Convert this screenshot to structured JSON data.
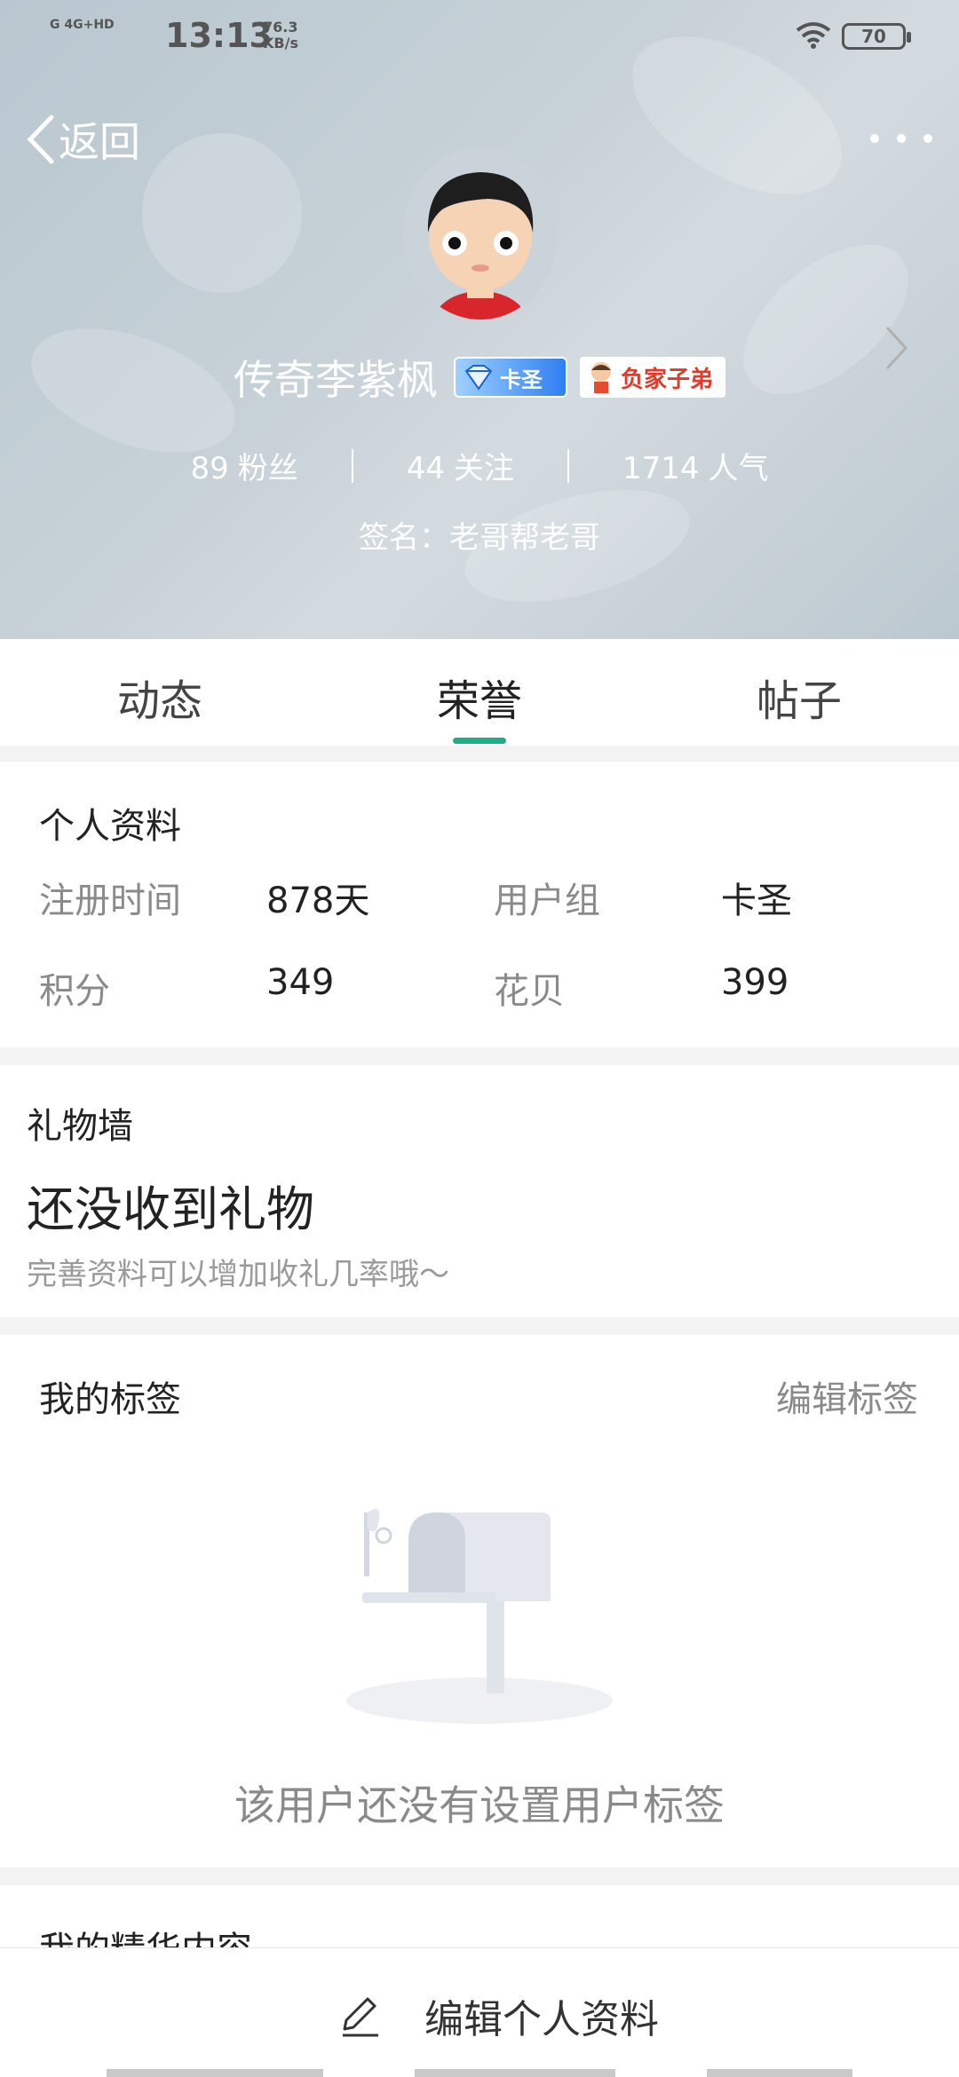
{
  "status_bar": {
    "signal": "G 4G+HD",
    "time": "13:13",
    "speed_value": "76.3",
    "speed_unit": "KB/s",
    "battery": "70"
  },
  "header": {
    "back_label": "返回",
    "user_name": "传奇李紫枫",
    "badge_level": "卡圣",
    "badge_title": "负家子弟",
    "stats": [
      {
        "value": "89",
        "label": "粉丝"
      },
      {
        "value": "44",
        "label": "关注"
      },
      {
        "value": "1714",
        "label": "人气"
      }
    ],
    "signature": "签名：老哥帮老哥"
  },
  "tabs": [
    {
      "label": "动态",
      "active": false
    },
    {
      "label": "荣誉",
      "active": true
    },
    {
      "label": "帖子",
      "active": false
    }
  ],
  "profile": {
    "title": "个人资料",
    "fields": [
      {
        "label": "注册时间",
        "value": "878天"
      },
      {
        "label": "用户组",
        "value": "卡圣"
      },
      {
        "label": "积分",
        "value": "349"
      },
      {
        "label": "花贝",
        "value": "399"
      }
    ]
  },
  "gifts": {
    "title": "礼物墙",
    "main": "还没收到礼物",
    "sub": "完善资料可以增加收礼几率哦～"
  },
  "tags": {
    "title": "我的标签",
    "edit_label": "编辑标签",
    "empty_text": "该用户还没有设置用户标签"
  },
  "featured": {
    "title": "我的精华内容"
  },
  "bottom": {
    "edit_profile_label": "编辑个人资料"
  },
  "colors": {
    "accent": "#1fae8a",
    "header_bg": "#c3ced5"
  }
}
